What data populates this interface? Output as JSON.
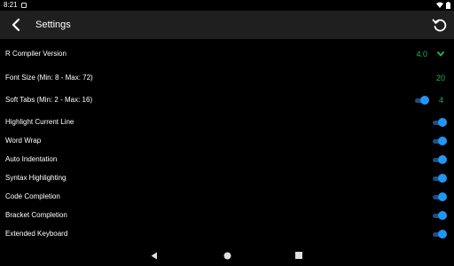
{
  "status_bar": {
    "time": "8:21"
  },
  "app_bar": {
    "title": "Settings",
    "back_icon": "arrow-back-icon",
    "reset_icon": "restore-icon"
  },
  "colors": {
    "accent_green": "#22b14c",
    "toggle_blue": "#2196f3",
    "app_bar_bg": "#1f1f1f",
    "background": "#000000"
  },
  "settings": {
    "compiler_version": {
      "label": "R Compiler Version",
      "value": "4.0"
    },
    "font_size": {
      "label": "Font Size (Min: 8 - Max: 72)",
      "value": "20"
    },
    "soft_tabs": {
      "label": "Soft Tabs (Min: 2 - Max: 16)",
      "value": "4",
      "enabled": true
    },
    "highlight_current_line": {
      "label": "Highlight Current Line",
      "enabled": true
    },
    "word_wrap": {
      "label": "Word Wrap",
      "enabled": true
    },
    "auto_indentation": {
      "label": "Auto Indentation",
      "enabled": true
    },
    "syntax_highlighting": {
      "label": "Syntax Highlighting",
      "enabled": true
    },
    "code_completion": {
      "label": "Code Completion",
      "enabled": true
    },
    "bracket_completion": {
      "label": "Bracket Completion",
      "enabled": true
    },
    "extended_keyboard": {
      "label": "Extended Keyboard",
      "enabled": true
    }
  },
  "nav_bar": {
    "back_icon": "nav-back-icon",
    "home_icon": "nav-home-icon",
    "recents_icon": "nav-recents-icon"
  }
}
